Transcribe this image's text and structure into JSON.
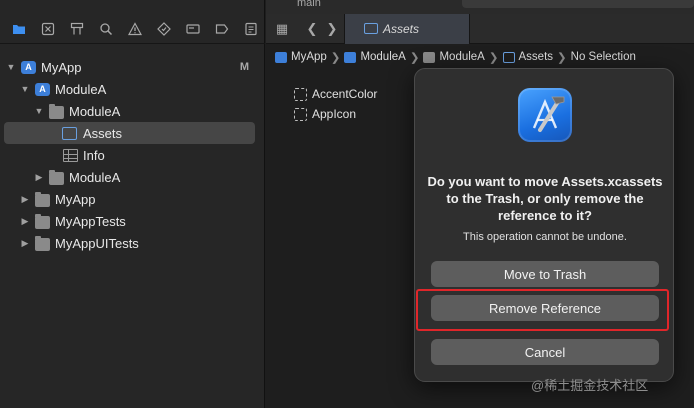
{
  "toolbar": {
    "branch": "main",
    "nav_icons": [
      "folder-icon",
      "source-control-icon",
      "hierarchy-icon",
      "find-icon",
      "issue-icon",
      "test-icon",
      "debug-icon",
      "breakpoint-icon",
      "report-icon"
    ]
  },
  "tree": [
    {
      "label": "MyApp",
      "badge": "M",
      "icon": "app-project-icon",
      "expanded": true
    },
    {
      "label": "ModuleA",
      "icon": "app-project-icon",
      "expanded": true
    },
    {
      "label": "ModuleA",
      "icon": "folder-icon",
      "expanded": true
    },
    {
      "label": "Assets",
      "icon": "asset-catalog-icon",
      "selected": true
    },
    {
      "label": "Info",
      "icon": "plist-icon"
    },
    {
      "label": "ModuleA",
      "icon": "folder-icon",
      "expanded": false
    },
    {
      "label": "MyApp",
      "icon": "folder-icon",
      "expanded": false
    },
    {
      "label": "MyAppTests",
      "icon": "folder-icon",
      "expanded": false
    },
    {
      "label": "MyAppUITests",
      "icon": "folder-icon",
      "expanded": false
    }
  ],
  "editor": {
    "tab_label": "Assets",
    "path": [
      "MyApp",
      "ModuleA",
      "ModuleA",
      "Assets",
      "No Selection"
    ],
    "assets": [
      "AccentColor",
      "AppIcon"
    ]
  },
  "dialog": {
    "title": "Do you want to move Assets.xcassets to the Trash, or only remove the reference to it?",
    "subtitle": "This operation cannot be undone.",
    "move_label": "Move to Trash",
    "remove_label": "Remove Reference",
    "cancel_label": "Cancel"
  },
  "watermark": "@稀土掘金技术社区",
  "colors": {
    "accent": "#3d7fd9",
    "highlight": "#e0262a"
  }
}
